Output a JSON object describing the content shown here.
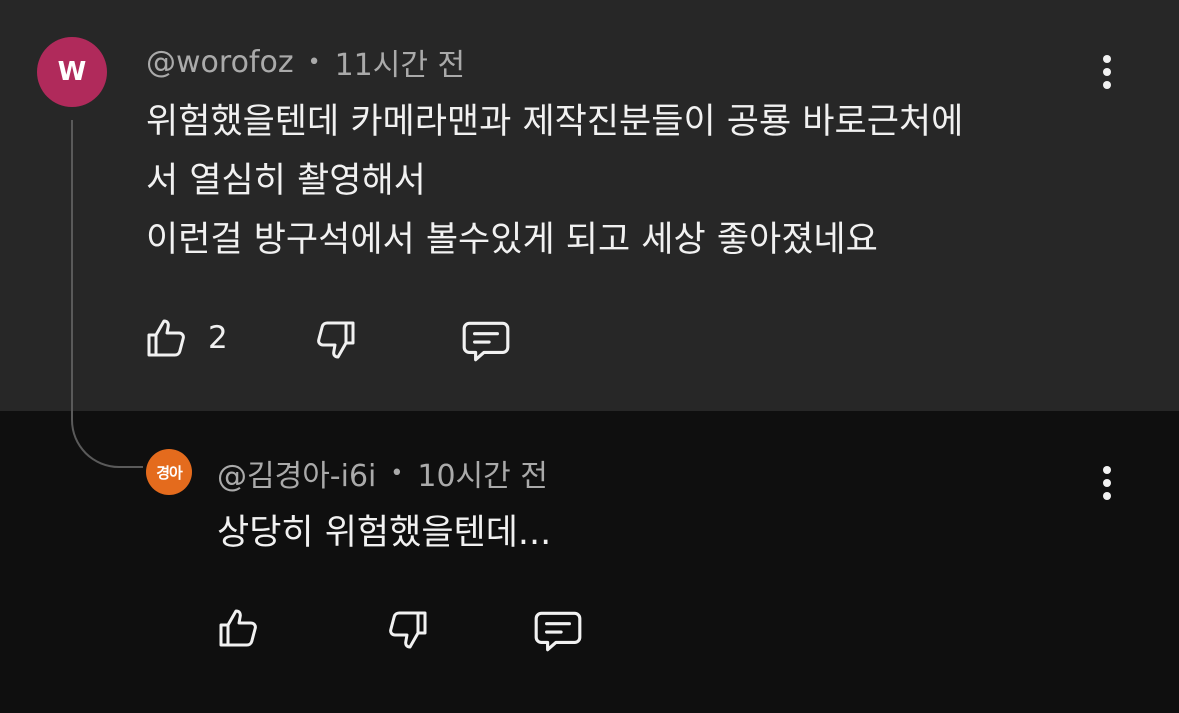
{
  "colors": {
    "parent_background": "#272727",
    "reply_background": "#0f0f0f",
    "avatar_main": "#b02a5b",
    "avatar_reply": "#e46b1d",
    "meta_text": "#aaaaaa",
    "body_text": "#f1f1f1"
  },
  "comment": {
    "avatar_letter": "W",
    "author": "@worofoz",
    "separator": "•",
    "time": "11시간 전",
    "text": "위험했을텐데 카메라맨과 제작진분들이 공룡 바로근처에\n서 열심히 촬영해서\n이런걸 방구석에서 볼수있게 되고 세상 좋아졌네요",
    "like_count": "2",
    "icons": [
      "thumbs-up-icon",
      "thumbs-down-icon",
      "reply-icon",
      "more-vert-icon"
    ]
  },
  "reply": {
    "avatar_text": "경아",
    "author": "@김경아-i6i",
    "separator": "•",
    "time": "10시간 전",
    "text": "상당히 위험했을텐데...",
    "icons": [
      "thumbs-up-icon",
      "thumbs-down-icon",
      "reply-icon",
      "more-vert-icon"
    ]
  }
}
